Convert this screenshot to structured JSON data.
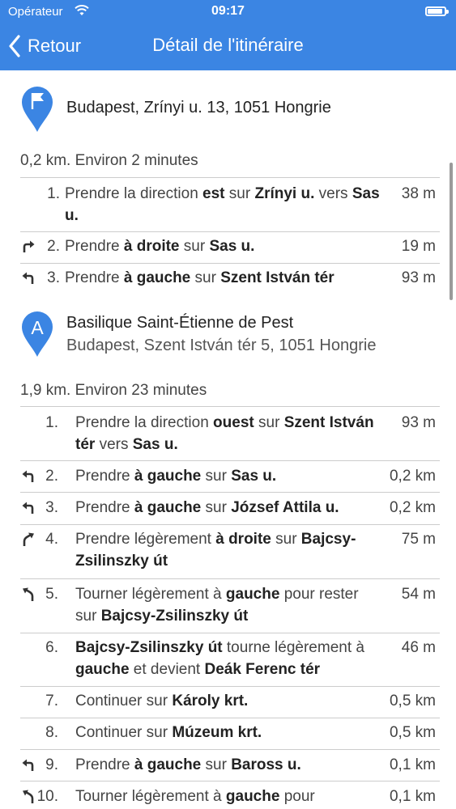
{
  "status_bar": {
    "carrier": "Opérateur",
    "time": "09:17",
    "battery_level": 1.0
  },
  "nav": {
    "back_label": "Retour",
    "title": "Détail de l'itinéraire"
  },
  "origin": {
    "address": "Budapest, Zrínyi u. 13, 1051 Hongrie",
    "icon": "flag-pin-icon"
  },
  "leg1": {
    "summary": "0,2 km. Environ 2 minutes",
    "steps": [
      {
        "num": "1.",
        "icon": "",
        "parts": [
          "Prendre la direction ",
          "est",
          " sur ",
          "Zrínyi u.",
          " vers ",
          "Sas u."
        ],
        "bold": [
          1,
          3,
          5
        ],
        "dist": "38 m"
      },
      {
        "num": "2.",
        "icon": "turn-right-icon",
        "parts": [
          "Prendre ",
          "à droite",
          " sur ",
          "Sas u."
        ],
        "bold": [
          1,
          3
        ],
        "dist": "19 m"
      },
      {
        "num": "3.",
        "icon": "turn-left-icon",
        "parts": [
          "Prendre ",
          "à gauche",
          " sur ",
          "Szent István tér"
        ],
        "bold": [
          1,
          3
        ],
        "dist": "93 m"
      }
    ]
  },
  "waypoint": {
    "label": "A",
    "name": "Basilique Saint-Étienne de Pest",
    "address": "Budapest, Szent István tér 5, 1051 Hongrie"
  },
  "leg2": {
    "summary": "1,9 km. Environ 23 minutes",
    "steps": [
      {
        "num": "1.",
        "icon": "",
        "parts": [
          "Prendre la direction ",
          "ouest",
          " sur ",
          "Szent István tér",
          " vers ",
          "Sas u."
        ],
        "bold": [
          1,
          3,
          5
        ],
        "dist": "93 m"
      },
      {
        "num": "2.",
        "icon": "turn-left-icon",
        "parts": [
          "Prendre ",
          "à gauche",
          " sur ",
          "Sas u."
        ],
        "bold": [
          1,
          3
        ],
        "dist": "0,2 km"
      },
      {
        "num": "3.",
        "icon": "turn-left-icon",
        "parts": [
          "Prendre ",
          "à gauche",
          " sur ",
          "József Attila u."
        ],
        "bold": [
          1,
          3
        ],
        "dist": "0,2 km"
      },
      {
        "num": "4.",
        "icon": "slight-right-icon",
        "parts": [
          "Prendre légèrement ",
          "à droite",
          " sur ",
          "Bajcsy-Zsilinszky út"
        ],
        "bold": [
          1,
          3
        ],
        "dist": "75 m"
      },
      {
        "num": "5.",
        "icon": "slight-left-icon",
        "parts": [
          "Tourner légèrement à ",
          "gauche",
          " pour rester sur ",
          "Bajcsy-Zsilinszky út"
        ],
        "bold": [
          1,
          3
        ],
        "dist": "54 m"
      },
      {
        "num": "6.",
        "icon": "",
        "parts": [
          "Bajcsy-Zsilinszky út",
          " tourne légèrement à ",
          "gauche",
          " et devient ",
          "Deák Ferenc tér"
        ],
        "bold": [
          0,
          2,
          4
        ],
        "dist": "46 m"
      },
      {
        "num": "7.",
        "icon": "",
        "parts": [
          "Continuer sur ",
          "Károly krt."
        ],
        "bold": [
          1
        ],
        "dist": "0,5 km"
      },
      {
        "num": "8.",
        "icon": "",
        "parts": [
          "Continuer sur ",
          "Múzeum krt."
        ],
        "bold": [
          1
        ],
        "dist": "0,5 km"
      },
      {
        "num": "9.",
        "icon": "turn-left-icon",
        "parts": [
          "Prendre ",
          "à gauche",
          " sur ",
          "Baross u."
        ],
        "bold": [
          1,
          3
        ],
        "dist": "0,1 km"
      },
      {
        "num": "10.",
        "icon": "slight-left-icon",
        "parts": [
          "Tourner légèrement à ",
          "gauche",
          " pour"
        ],
        "bold": [
          1
        ],
        "dist": "0,1 km"
      }
    ]
  },
  "colors": {
    "header": "#3b85e3",
    "pin": "#3b85e3"
  }
}
